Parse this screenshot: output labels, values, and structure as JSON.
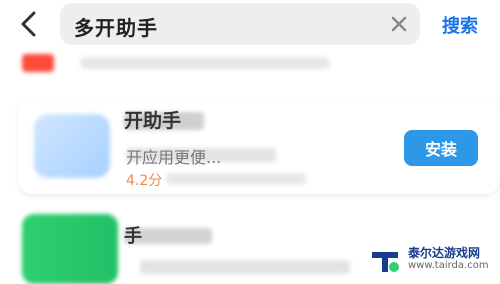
{
  "topbar": {
    "search_value": "多开助手",
    "search_action_label": "搜索"
  },
  "results": [
    {
      "name": "开助手",
      "description": "开应用更便...",
      "rating": "4.2分",
      "action_label": "安装"
    },
    {
      "name": "手"
    }
  ],
  "watermark": {
    "title": "泰尔达游戏网",
    "url": "www.tairda.com"
  },
  "colors": {
    "accent": "#2f97e8",
    "search_link": "#1a73e8",
    "rating": "#f08a4b"
  },
  "icons": {
    "back": "chevron-left-icon",
    "clear": "close-icon",
    "watermark_logo": "tairda-logo-icon"
  }
}
